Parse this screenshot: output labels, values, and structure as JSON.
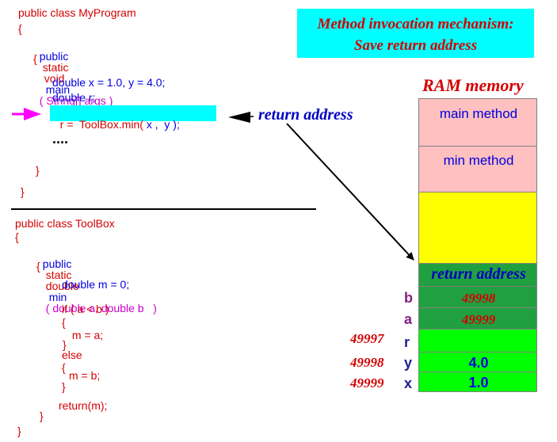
{
  "title": {
    "line1": "Method invocation mechanism:",
    "line2": "Save return address",
    "bg": "#00ffff",
    "color": "#d40000"
  },
  "program": {
    "class_decl": "public class MyProgram",
    "open_brace": "{",
    "main_public": "public",
    "main_static": "static",
    "main_void": "void",
    "main_name": "main",
    "main_params": "( String[] args )",
    "main_open": "{",
    "line_decl_xy": "double x = 1.0, y = 4.0;",
    "line_decl_r": "double r;",
    "call_prefix": "r =  ToolBox.min(",
    "call_args": " x ,  y );",
    "dots": "....",
    "main_close": "}",
    "class_close": "}"
  },
  "toolbox": {
    "class_decl": "public class ToolBox",
    "open_brace": "{",
    "min_public": "public",
    "min_static": "static",
    "min_double": "double",
    "min_name": "min",
    "min_params": "( double a, double b   )",
    "min_open": "{",
    "line_decl_m": "double m = 0;",
    "if_line": "if ( a < b )",
    "if_open": "{",
    "m_eq_a": " m = a;",
    "if_close": "}",
    "else": "else",
    "else_open": "{",
    "m_eq_b": "m = b;",
    "else_close": "}",
    "return_line": "return(m);",
    "min_close": "}",
    "class_close": "}"
  },
  "return_address_label": "return address",
  "ram": {
    "title": "RAM memory",
    "cells": [
      {
        "label": "main method",
        "color": "#ffc0c0"
      },
      {
        "label": "min method",
        "color": "#ffc0c0"
      },
      {
        "label": "",
        "color": "#ffff00"
      },
      {
        "label": "return address",
        "color": "#20a040"
      },
      {
        "var": "b",
        "value": "49998",
        "address": "",
        "color": "#20a040"
      },
      {
        "var": "a",
        "value": "49999",
        "address": "",
        "color": "#20a040"
      },
      {
        "var": "r",
        "value": "",
        "address": "49997",
        "color": "#00ff00"
      },
      {
        "var": "y",
        "value": "4.0",
        "address": "49998",
        "color": "#00ff00"
      },
      {
        "var": "x",
        "value": "1.0",
        "address": "49999",
        "color": "#00ff00"
      }
    ]
  },
  "colors": {
    "keyword": "#d40000",
    "method_call_highlight": "#00ffff",
    "arrow": "#000000",
    "pointer_arrow": "#ff00ff"
  }
}
